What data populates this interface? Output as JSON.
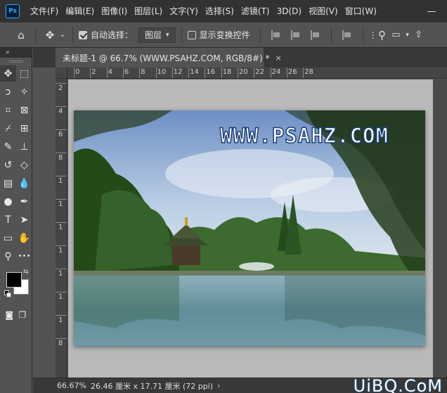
{
  "app": {
    "logo_text": "Ps"
  },
  "menu": [
    {
      "label": "文件(F)"
    },
    {
      "label": "编辑(E)"
    },
    {
      "label": "图像(I)"
    },
    {
      "label": "图层(L)"
    },
    {
      "label": "文字(Y)"
    },
    {
      "label": "选择(S)"
    },
    {
      "label": "滤镜(T)"
    },
    {
      "label": "3D(D)"
    },
    {
      "label": "视图(V)"
    },
    {
      "label": "窗口(W)"
    }
  ],
  "options": {
    "auto_select_label": "自动选择：",
    "auto_select_checked": true,
    "layer_target": "图层",
    "show_transform_label": "显示变换控件",
    "show_transform_checked": false
  },
  "toolbar": {
    "collapse_glyph": "«",
    "tools": [
      {
        "name": "move-tool",
        "glyph": "✥",
        "active": true
      },
      {
        "name": "marquee-tool",
        "glyph": "⬚"
      },
      {
        "name": "lasso-tool",
        "glyph": "ↄ"
      },
      {
        "name": "magic-wand-tool",
        "glyph": "✧"
      },
      {
        "name": "crop-tool",
        "glyph": "⌗"
      },
      {
        "name": "frame-tool",
        "glyph": "⊠"
      },
      {
        "name": "eyedropper-tool",
        "glyph": "⌿"
      },
      {
        "name": "healing-tool",
        "glyph": "⊞"
      },
      {
        "name": "brush-tool",
        "glyph": "✎"
      },
      {
        "name": "stamp-tool",
        "glyph": "⊥"
      },
      {
        "name": "history-brush-tool",
        "glyph": "↺"
      },
      {
        "name": "eraser-tool",
        "glyph": "◇"
      },
      {
        "name": "gradient-tool",
        "glyph": "▤"
      },
      {
        "name": "blur-tool",
        "glyph": "💧"
      },
      {
        "name": "dodge-tool",
        "glyph": "●"
      },
      {
        "name": "pen-tool",
        "glyph": "✒"
      },
      {
        "name": "type-tool",
        "glyph": "T"
      },
      {
        "name": "path-select-tool",
        "glyph": "➤"
      },
      {
        "name": "shape-tool",
        "glyph": "▭"
      },
      {
        "name": "hand-tool",
        "glyph": "✋"
      },
      {
        "name": "zoom-tool",
        "glyph": "⚲"
      },
      {
        "name": "more-tools",
        "glyph": "•••"
      }
    ],
    "swap_glyph": "⇆",
    "quickmask_glyph": "◙",
    "screenmode_glyph": "❐",
    "fg_color": "#000000",
    "bg_color": "#ffffff"
  },
  "document": {
    "tab_title": "未标题-1 @ 66.7% (WWW.PSAHZ.COM, RGB/8#) *",
    "close_glyph": "×",
    "image_text": "WWW.PSAHZ.COM"
  },
  "rulers": {
    "top": [
      "0",
      "2",
      "4",
      "6",
      "8",
      "10",
      "12",
      "14",
      "16",
      "18",
      "20",
      "22",
      "24",
      "26",
      "28"
    ],
    "left": [
      "2",
      "4",
      "6",
      "8",
      "1",
      "1",
      "1",
      "1",
      "1",
      "1",
      "1",
      "8"
    ]
  },
  "status": {
    "zoom": "66.67%",
    "doc_size": "26.46 厘米 x 17.71 厘米 (72 ppi)",
    "arrow": "›"
  },
  "watermark": "UiBQ.CoM"
}
